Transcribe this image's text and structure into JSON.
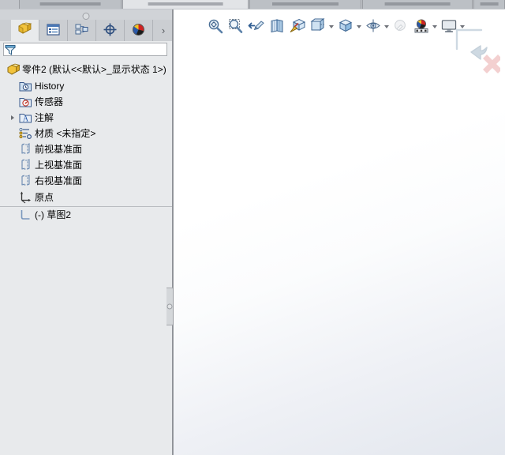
{
  "app": {
    "title": "SOLIDWORKS",
    "accent_color": "#e8eaec",
    "panel_color": "#d4d7da",
    "origin_color": "#e02020"
  },
  "ribbon": {
    "tabs": [
      {
        "name": "tab-features",
        "label": ""
      },
      {
        "name": "tab-sketch",
        "label": "",
        "selected": true
      },
      {
        "name": "tab-markup",
        "label": ""
      },
      {
        "name": "tab-evaluate",
        "label": ""
      },
      {
        "name": "tab-mbd",
        "label": ""
      },
      {
        "name": "tab-addins",
        "label": ""
      },
      {
        "name": "tab-simulation",
        "label": ""
      },
      {
        "name": "tab-more",
        "label": ""
      }
    ]
  },
  "manager_panel": {
    "tabs": [
      {
        "id": "feature-manager",
        "icon": "part-tree-icon",
        "label": "FeatureManager 设计树",
        "active": true
      },
      {
        "id": "property-manager",
        "icon": "property-list-icon",
        "label": "PropertyManager"
      },
      {
        "id": "configuration-manager",
        "icon": "configuration-icon",
        "label": "ConfigurationManager"
      },
      {
        "id": "dimxpert-manager",
        "icon": "dimxpert-icon",
        "label": "DimXpertManager"
      },
      {
        "id": "appearance-manager",
        "icon": "appearances-sphere-icon",
        "label": "外观、布景和贴图"
      }
    ],
    "more_label": "›",
    "filter": {
      "icon": "filter-funnel-icon",
      "value": "",
      "placeholder": ""
    },
    "tree": [
      {
        "id": "root",
        "label": "零件2  (默认<<默认>_显示状态 1>)",
        "icon": "part-icon",
        "indent": 0,
        "expandable": false
      },
      {
        "id": "history",
        "label": "History",
        "icon": "history-icon",
        "indent": 1,
        "expandable": false
      },
      {
        "id": "sensors",
        "label": "传感器",
        "icon": "sensor-icon",
        "indent": 1,
        "expandable": false
      },
      {
        "id": "annotations",
        "label": "注解",
        "icon": "annotations-folder-icon",
        "indent": 1,
        "expandable": true
      },
      {
        "id": "material",
        "label": "材质 <未指定>",
        "icon": "material-icon",
        "indent": 1,
        "expandable": false
      },
      {
        "id": "front-plane",
        "label": "前视基准面",
        "icon": "plane-icon",
        "indent": 1,
        "expandable": false
      },
      {
        "id": "top-plane",
        "label": "上视基准面",
        "icon": "plane-icon",
        "indent": 1,
        "expandable": false
      },
      {
        "id": "right-plane",
        "label": "右视基准面",
        "icon": "plane-icon",
        "indent": 1,
        "expandable": false
      },
      {
        "id": "origin",
        "label": "原点",
        "icon": "origin-axes-icon",
        "indent": 1,
        "expandable": false
      },
      {
        "id": "sketch2",
        "label": "(-) 草图2",
        "icon": "sketch-icon",
        "indent": 1,
        "expandable": false
      }
    ]
  },
  "viewport": {
    "toolbar": [
      {
        "id": "zoom-to-fit",
        "icon": "zoom-to-fit-icon",
        "label": "整屏显示全图",
        "caret": false
      },
      {
        "id": "zoom-to-area",
        "icon": "zoom-to-area-icon",
        "label": "局部放大",
        "caret": false
      },
      {
        "id": "previous-view",
        "icon": "previous-view-icon",
        "label": "上一视图",
        "caret": false
      },
      {
        "id": "section-view",
        "icon": "section-view-icon",
        "label": "剖面视图",
        "caret": false
      },
      {
        "id": "view-orientation",
        "icon": "view-orientation-icon",
        "label": "视图定向",
        "caret": false
      },
      {
        "id": "display-style",
        "icon": "display-style-icon",
        "label": "显示样式",
        "caret": true
      },
      {
        "id": "display-style-2",
        "icon": "display-cube-icon",
        "label": "显示类型",
        "caret": true
      },
      {
        "id": "hide-show-items",
        "icon": "hide-show-eye-icon",
        "label": "隐藏/显示项目",
        "caret": true
      },
      {
        "id": "edit-appearance",
        "icon": "edit-appearance-icon",
        "label": "编辑外观",
        "caret": false
      },
      {
        "id": "apply-scene",
        "icon": "apply-scene-icon",
        "label": "应用布景",
        "caret": true
      },
      {
        "id": "view-settings",
        "icon": "view-settings-monitor-icon",
        "label": "视图设定",
        "caret": true
      }
    ],
    "confirm_corner": {
      "accept": {
        "icon": "sketch-exit-arrow-icon",
        "label": "退出草图"
      },
      "cancel": {
        "icon": "cancel-x-icon",
        "label": "取消"
      }
    },
    "origin_marker": {
      "icon": "origin-axes-marker",
      "label": "原点"
    }
  }
}
